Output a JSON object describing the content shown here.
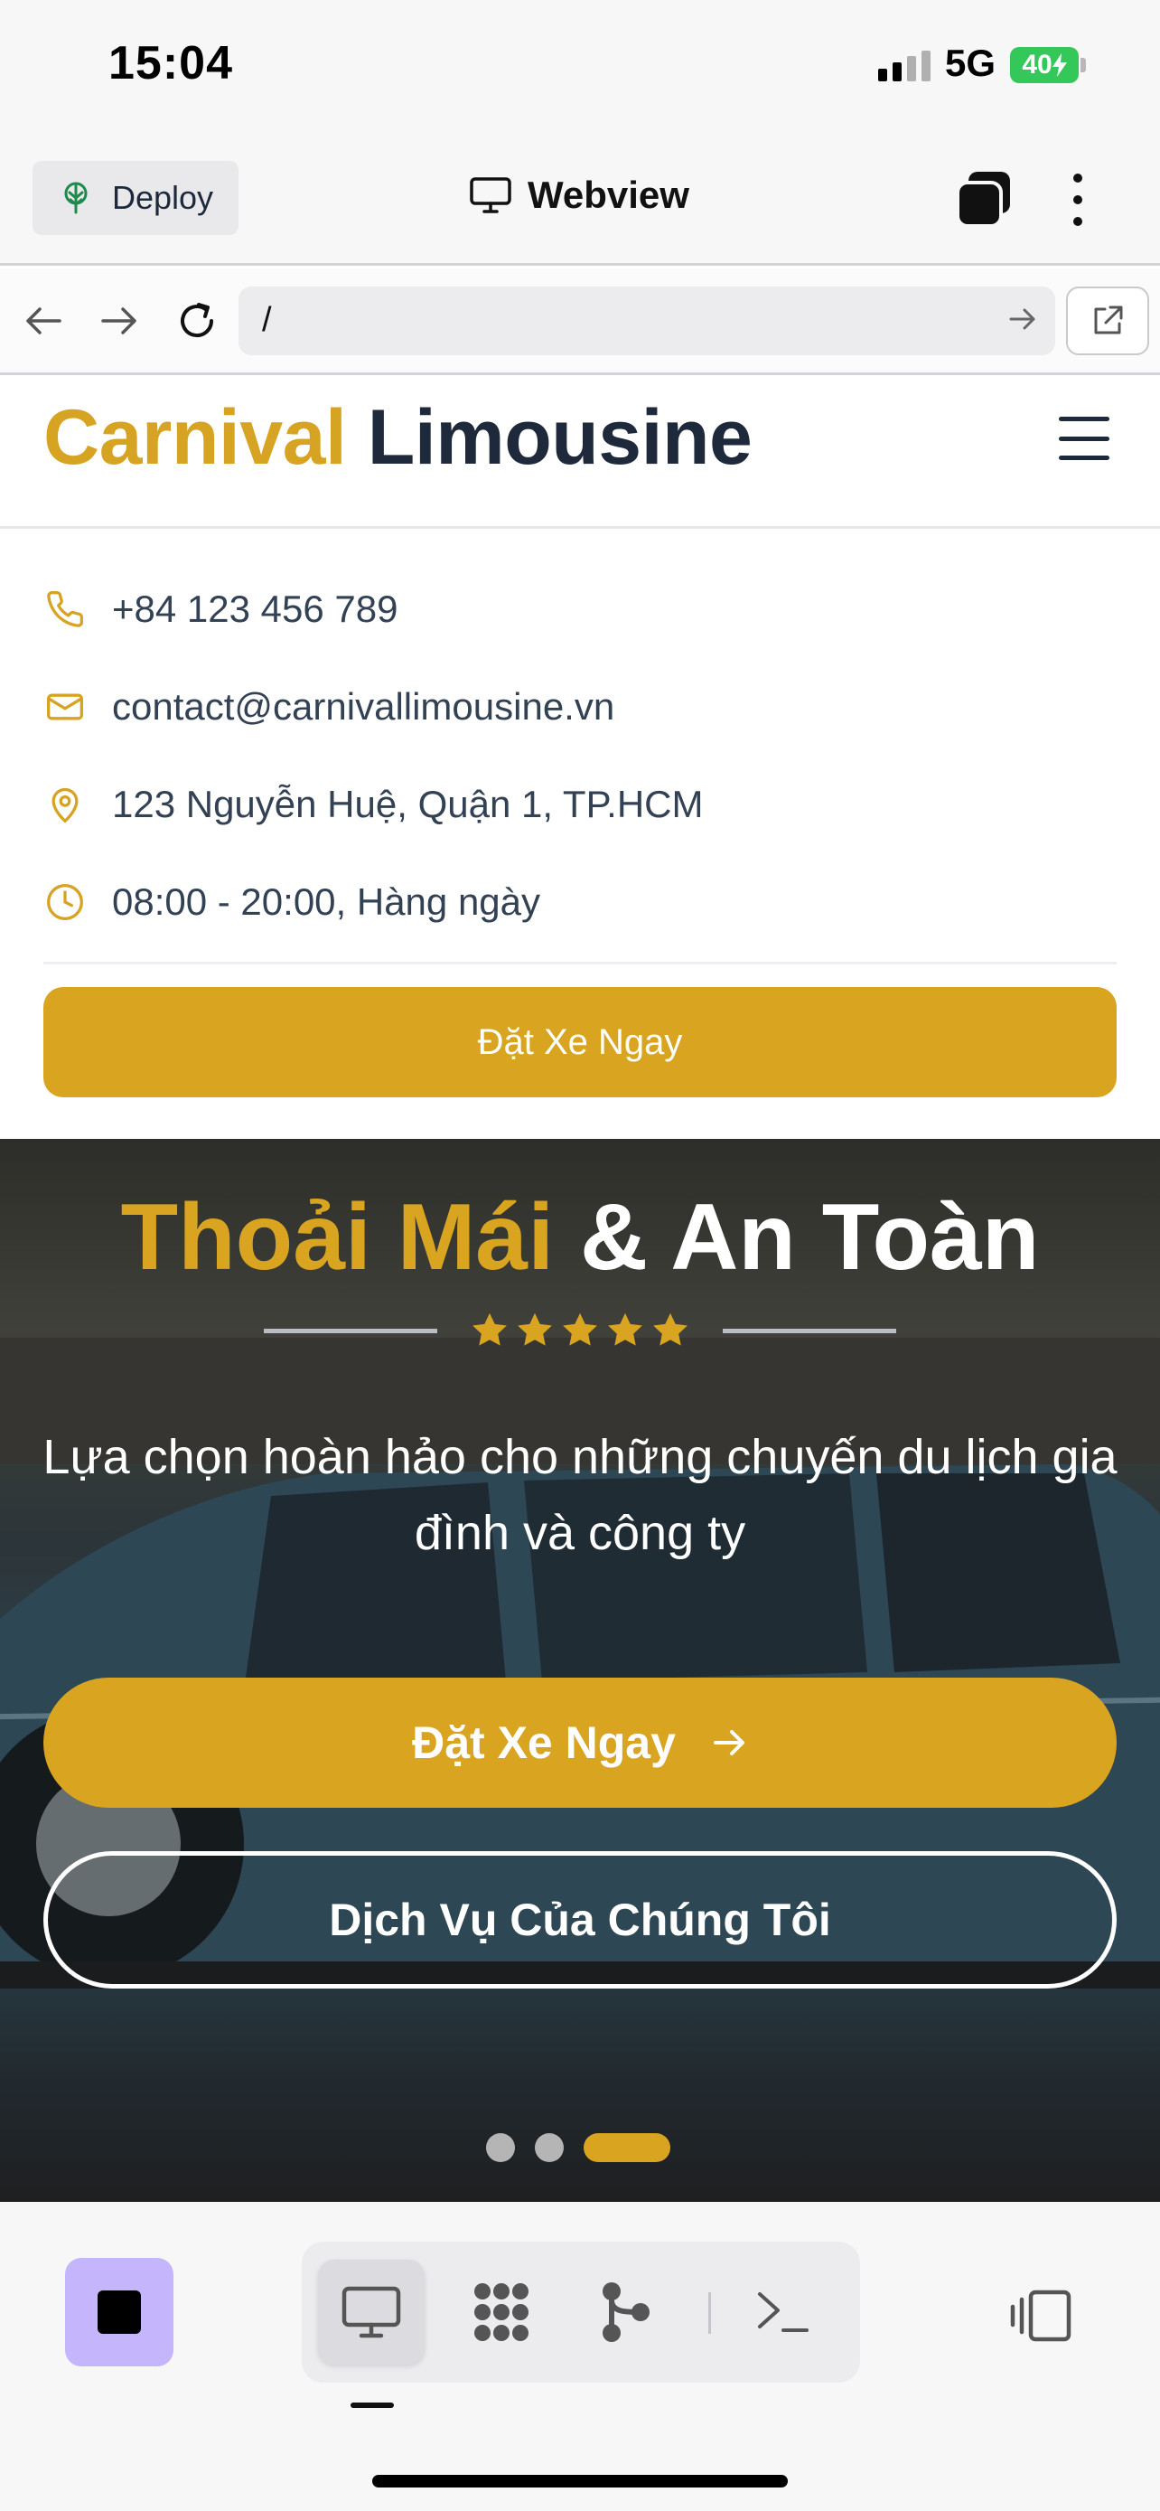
{
  "status_bar": {
    "time": "15:04",
    "network": "5G",
    "battery": "40"
  },
  "toolbar": {
    "deploy_label": "Deploy",
    "title": "Webview"
  },
  "address_bar": {
    "url": "/"
  },
  "site": {
    "brand_part1": "Carnival",
    "brand_part2": "Limousine",
    "contact": {
      "phone": "+84 123 456 789",
      "email": "contact@carnivallimousine.vn",
      "address": "123 Nguyễn Huệ, Quận 1, TP.HCM",
      "hours": "08:00 - 20:00, Hàng ngày"
    },
    "book_button": "Đặt Xe Ngay"
  },
  "hero": {
    "title_gold": "Thoải Mái",
    "title_white": "& An Toàn",
    "rating_stars": 5,
    "subtitle": "Lựa chọn hoàn hảo cho những chuyến du lịch gia đình và công ty",
    "cta_label": "Đặt Xe Ngay",
    "secondary_label": "Dịch Vụ Của Chúng Tôi",
    "slides_total": 3,
    "slide_active": 3
  },
  "colors": {
    "accent": "#d9a521",
    "brand_dark": "#1e293b",
    "stop_button": "#c4b5fd"
  },
  "bottom_bar": {
    "tools": [
      "webview-icon",
      "apps-icon",
      "git-icon",
      "terminal-icon"
    ],
    "active_tool": "webview-icon"
  }
}
